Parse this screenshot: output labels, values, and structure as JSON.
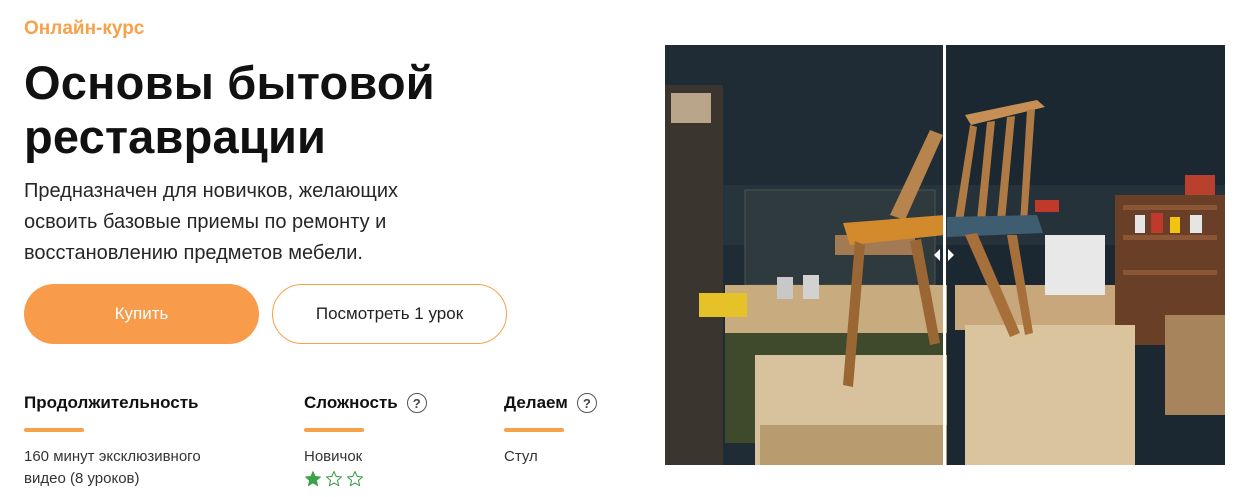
{
  "eyebrow": "Онлайн-курс",
  "title": "Основы бытовой реставрации",
  "description": "Предназначен для новичков, желающих освоить базовые приемы по ремонту и восстановлению предметов мебели.",
  "buttons": {
    "buy": "Купить",
    "watch_lesson": "Посмотреть 1 урок"
  },
  "info": {
    "duration": {
      "label": "Продолжительность",
      "value": "160 минут эксклюзивного видео (8 уроков)"
    },
    "difficulty": {
      "label": "Сложность",
      "value": "Новичок",
      "rating": 1,
      "rating_max": 3
    },
    "making": {
      "label": "Делаем",
      "value": "Стул"
    }
  },
  "icons": {
    "help": "question-circle-icon",
    "star_filled": "star-filled-icon",
    "star_empty": "star-outline-icon",
    "compare": "arrow-left-right-icon"
  },
  "colors": {
    "accent": "#f7a14b",
    "button": "#f89c4c",
    "star": "#3ca24a"
  }
}
